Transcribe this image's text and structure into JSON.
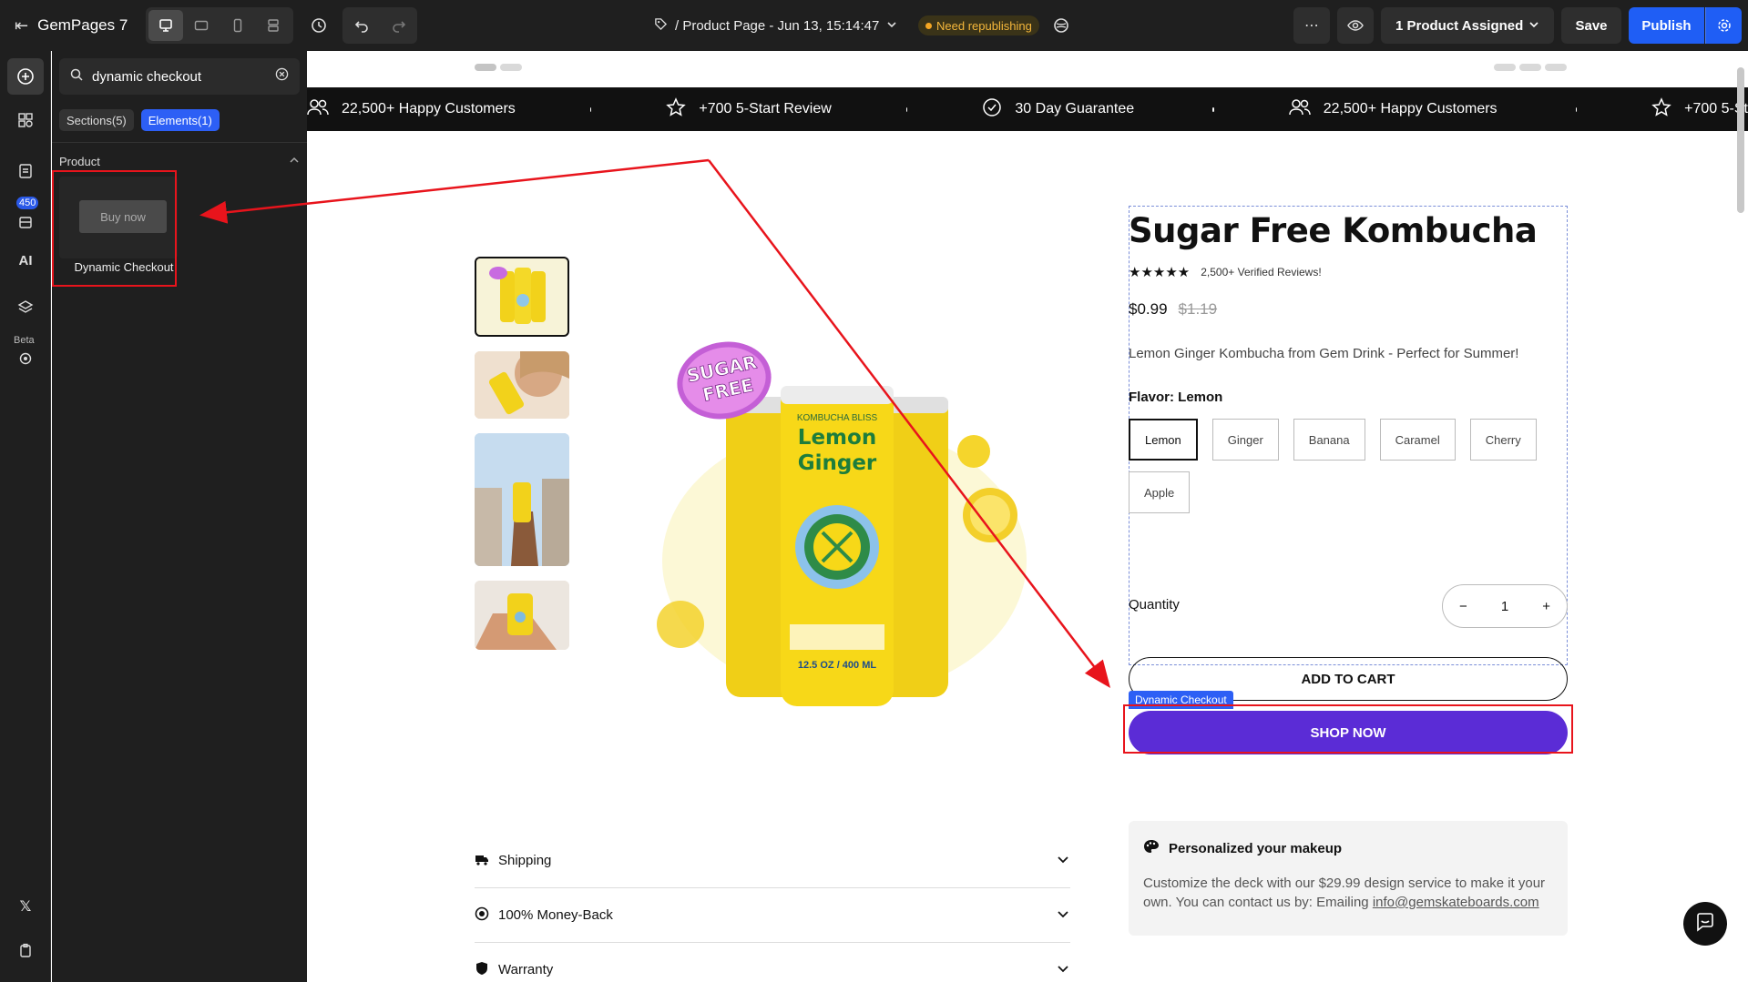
{
  "app": {
    "brand": "GemPages 7"
  },
  "topbar": {
    "page_title": "/ Product Page - Jun 13, 15:14:47",
    "republish": "Need republishing",
    "assigned": "1 Product Assigned",
    "save": "Save",
    "publish": "Publish"
  },
  "rail": {
    "badge": "450",
    "beta": "Beta"
  },
  "panel": {
    "search_value": "dynamic checkout",
    "tabs": [
      "Sections(5)",
      "Elements(1)"
    ],
    "section_title": "Product",
    "element_thumb": "Buy now",
    "element_caption": "Dynamic Checkout"
  },
  "marquee": {
    "items": [
      "22,500+ Happy Customers",
      "+700 5-Start Review",
      "30 Day Guarantee",
      "22,500+ Happy Customers",
      "+700 5-St"
    ]
  },
  "product": {
    "title": "Sugar Free Kombucha",
    "reviews": "2,500+ Verified Reviews!",
    "price": "$0.99",
    "old_price": "$1.19",
    "description": "Lemon Ginger Kombucha from Gem Drink - Perfect for Summer!",
    "flavor_label": "Flavor: Lemon",
    "flavors": [
      "Lemon",
      "Ginger",
      "Banana",
      "Caramel",
      "Cherry",
      "Apple"
    ],
    "quantity_label": "Quantity",
    "quantity": "1",
    "add_to_cart": "ADD TO CART",
    "dynamic_tag": "Dynamic Checkout",
    "shop_now": "SHOP NOW",
    "can_label_1": "Lemon",
    "can_label_2": "Ginger",
    "can_brand": "KOMBUCHA BLISS",
    "can_volume": "12.5 OZ / 400 ML",
    "badge_1": "SUGAR",
    "badge_2": "FREE"
  },
  "accordion": [
    "Shipping",
    "100% Money-Back",
    "Warranty"
  ],
  "promo": {
    "title": "Personalized your makeup",
    "text": "Customize the deck with our $29.99 design service to make it your own. You can contact us by: Emailing ",
    "email": "info@gemskateboards.com"
  },
  "colors": {
    "accent": "#2d5ff5",
    "shop_now": "#5b2cd6",
    "annotation": "#e8141c",
    "can_yellow": "#f2d21b"
  }
}
